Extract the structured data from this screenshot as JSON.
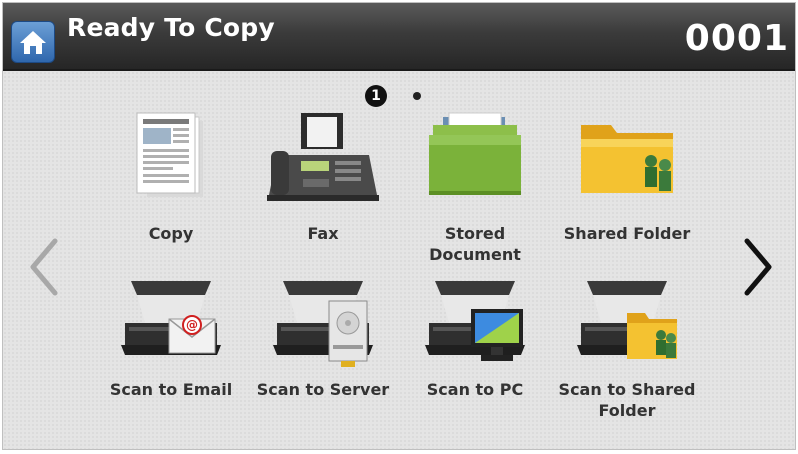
{
  "header": {
    "title": "Ready To Copy",
    "counter": "0001"
  },
  "pager": {
    "current_page": "1",
    "total_pages": 2
  },
  "apps": [
    {
      "label": "Copy",
      "icon": "copy-document-icon"
    },
    {
      "label": "Fax",
      "icon": "fax-machine-icon"
    },
    {
      "label": "Stored Document",
      "icon": "stored-document-folder-icon"
    },
    {
      "label": "Shared Folder",
      "icon": "shared-folder-icon"
    },
    {
      "label": "Scan to Email",
      "icon": "scan-to-email-icon"
    },
    {
      "label": "Scan to Server",
      "icon": "scan-to-server-icon"
    },
    {
      "label": "Scan to PC",
      "icon": "scan-to-pc-icon"
    },
    {
      "label": "Scan to Shared Folder",
      "icon": "scan-to-shared-folder-icon"
    }
  ],
  "colors": {
    "header_top": "#5a5a5a",
    "header_bottom": "#262626",
    "home_button": "#2f67ad",
    "label_text": "#333333",
    "background": "#e4e4e4"
  }
}
